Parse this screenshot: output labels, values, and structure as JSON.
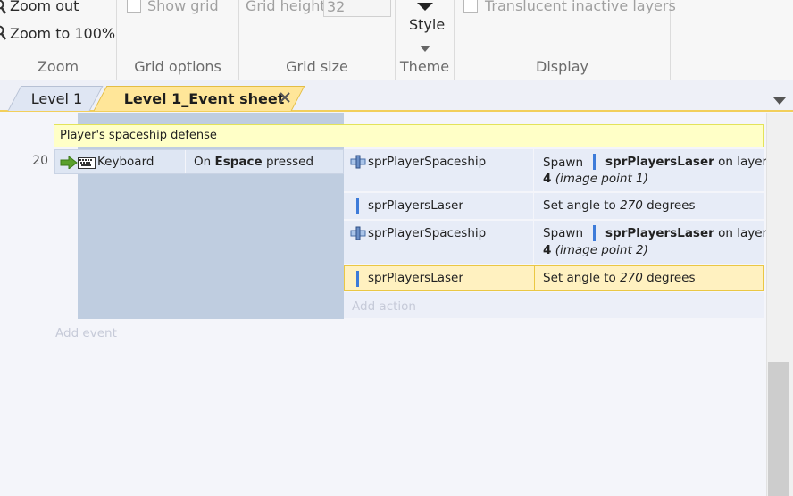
{
  "ribbon": {
    "zoom_out": "Zoom out",
    "zoom_100": "Zoom to 100%",
    "zoom_group": "Zoom",
    "show_grid": "Show grid",
    "grid_options_group": "Grid options",
    "grid_height_label": "Grid height",
    "grid_height_value": "32",
    "grid_size_group": "Grid size",
    "style_label": "Style",
    "theme_group": "Theme",
    "translucent": "Translucent inactive layers",
    "display_group": "Display"
  },
  "tabs": [
    {
      "label": "Level 1"
    },
    {
      "label": "Level 1_Event sheet"
    }
  ],
  "sheet": {
    "comment": "Player's spaceship defense",
    "event_number": "20",
    "condition": {
      "object": "Keyboard",
      "text_prefix": "On ",
      "text_bold": "Espace",
      "text_suffix": " pressed"
    },
    "actions": [
      {
        "object": "sprPlayerSpaceship",
        "a1": "Spawn",
        "a2": "sprPlayersLaser",
        "a3": "on layer",
        "a4": "4",
        "a5": "(image point 1)"
      },
      {
        "object": "sprPlayersLaser",
        "t1": "Set angle to ",
        "t2": "270",
        "t3": " degrees"
      },
      {
        "object": "sprPlayerSpaceship",
        "a1": "Spawn",
        "a2": "sprPlayersLaser",
        "a3": "on layer",
        "a4": "4",
        "a5": "(image point 2)"
      },
      {
        "object": "sprPlayersLaser",
        "t1": "Set angle to ",
        "t2": "270",
        "t3": " degrees"
      }
    ],
    "add_action": "Add action",
    "add_event": "Add event"
  },
  "colors": {
    "accent_tab": "#ffe699",
    "selected_row": "#fff1c0",
    "comment_bg": "#ffffc7"
  }
}
